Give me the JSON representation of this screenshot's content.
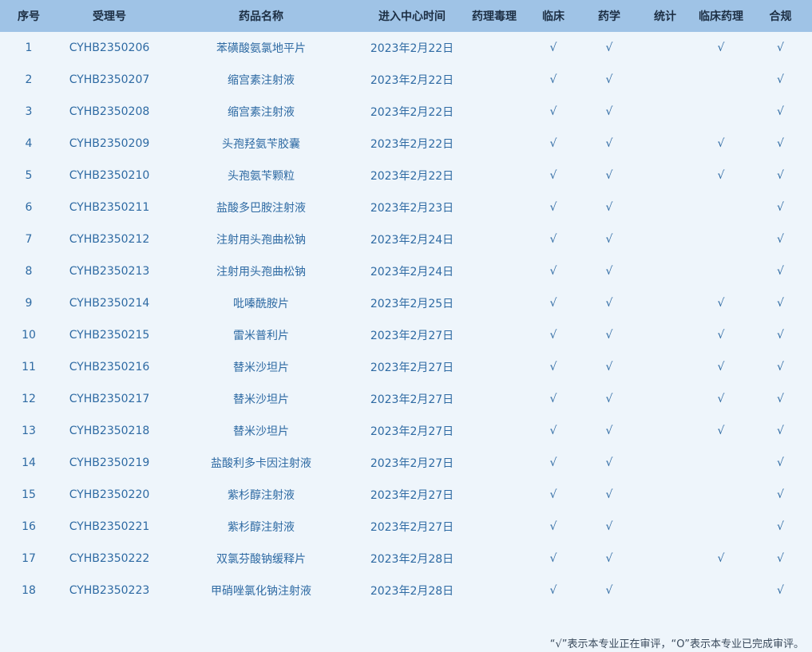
{
  "table": {
    "headers": [
      "序号",
      "受理号",
      "药品名称",
      "进入中心时间",
      "药理毒理",
      "临床",
      "药学",
      "统计",
      "临床药理",
      "合规"
    ],
    "rows": [
      [
        "1",
        "CYHB2350206",
        "苯磺酸氨氯地平片",
        "2023年2月22日",
        "",
        "√",
        "√",
        "",
        "√",
        "√"
      ],
      [
        "2",
        "CYHB2350207",
        "缩宫素注射液",
        "2023年2月22日",
        "",
        "√",
        "√",
        "",
        "",
        "√"
      ],
      [
        "3",
        "CYHB2350208",
        "缩宫素注射液",
        "2023年2月22日",
        "",
        "√",
        "√",
        "",
        "",
        "√"
      ],
      [
        "4",
        "CYHB2350209",
        "头孢羟氨苄胶囊",
        "2023年2月22日",
        "",
        "√",
        "√",
        "",
        "√",
        "√"
      ],
      [
        "5",
        "CYHB2350210",
        "头孢氨苄颗粒",
        "2023年2月22日",
        "",
        "√",
        "√",
        "",
        "√",
        "√"
      ],
      [
        "6",
        "CYHB2350211",
        "盐酸多巴胺注射液",
        "2023年2月23日",
        "",
        "√",
        "√",
        "",
        "",
        "√"
      ],
      [
        "7",
        "CYHB2350212",
        "注射用头孢曲松钠",
        "2023年2月24日",
        "",
        "√",
        "√",
        "",
        "",
        "√"
      ],
      [
        "8",
        "CYHB2350213",
        "注射用头孢曲松钠",
        "2023年2月24日",
        "",
        "√",
        "√",
        "",
        "",
        "√"
      ],
      [
        "9",
        "CYHB2350214",
        "吡嗪酰胺片",
        "2023年2月25日",
        "",
        "√",
        "√",
        "",
        "√",
        "√"
      ],
      [
        "10",
        "CYHB2350215",
        "雷米普利片",
        "2023年2月27日",
        "",
        "√",
        "√",
        "",
        "√",
        "√"
      ],
      [
        "11",
        "CYHB2350216",
        "替米沙坦片",
        "2023年2月27日",
        "",
        "√",
        "√",
        "",
        "√",
        "√"
      ],
      [
        "12",
        "CYHB2350217",
        "替米沙坦片",
        "2023年2月27日",
        "",
        "√",
        "√",
        "",
        "√",
        "√"
      ],
      [
        "13",
        "CYHB2350218",
        "替米沙坦片",
        "2023年2月27日",
        "",
        "√",
        "√",
        "",
        "√",
        "√"
      ],
      [
        "14",
        "CYHB2350219",
        "盐酸利多卡因注射液",
        "2023年2月27日",
        "",
        "√",
        "√",
        "",
        "",
        "√"
      ],
      [
        "15",
        "CYHB2350220",
        "紫杉醇注射液",
        "2023年2月27日",
        "",
        "√",
        "√",
        "",
        "",
        "√"
      ],
      [
        "16",
        "CYHB2350221",
        "紫杉醇注射液",
        "2023年2月27日",
        "",
        "√",
        "√",
        "",
        "",
        "√"
      ],
      [
        "17",
        "CYHB2350222",
        "双氯芬酸钠缓释片",
        "2023年2月28日",
        "",
        "√",
        "√",
        "",
        "√",
        "√"
      ],
      [
        "18",
        "CYHB2350223",
        "甲硝唑氯化钠注射液",
        "2023年2月28日",
        "",
        "√",
        "√",
        "",
        "",
        "√"
      ]
    ]
  },
  "footnote": "“√”表示本专业正在审评，“O”表示本专业已完成审评。",
  "colors": {
    "header_bg": "#9fc3e6",
    "body_bg": "#eef5fb",
    "cell_text": "#2e6aa3",
    "header_text": "#1d2f44"
  }
}
